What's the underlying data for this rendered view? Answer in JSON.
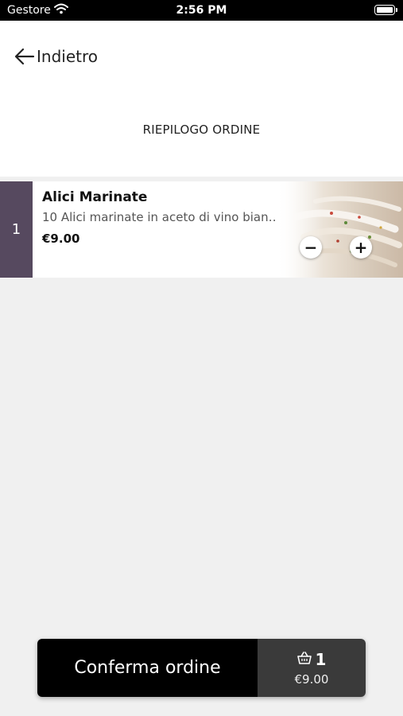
{
  "status_bar": {
    "carrier": "Gestore",
    "time": "2:56 PM"
  },
  "header": {
    "back_label": "Indietro",
    "title": "RIEPILOGO ORDINE"
  },
  "order_items": [
    {
      "quantity": "1",
      "name": "Alici Marinate",
      "description": "10 Alici marinate in aceto di vino bianco...",
      "price": "€9.00",
      "minus_symbol": "−",
      "plus_symbol": "+"
    }
  ],
  "footer": {
    "confirm_label": "Conferma ordine",
    "cart_count": "1",
    "cart_total": "€9.00"
  },
  "colors": {
    "quantity_strip": "#56495f",
    "confirm_button": "#000000",
    "cart_summary": "#3a3a3a"
  },
  "icons": [
    "wifi-icon",
    "battery-icon",
    "back-arrow-icon",
    "basket-icon",
    "minus-icon",
    "plus-icon"
  ]
}
